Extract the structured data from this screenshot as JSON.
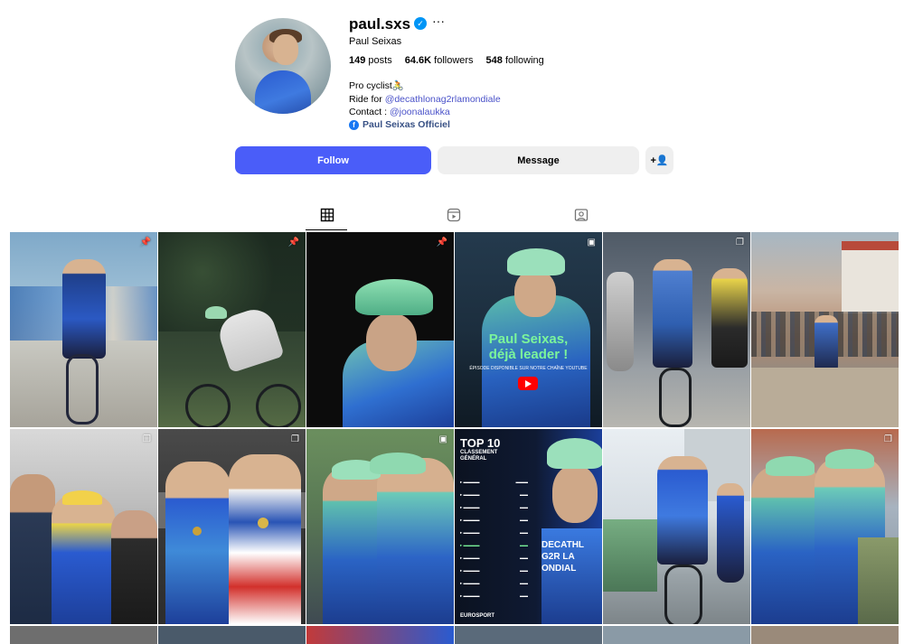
{
  "profile": {
    "username": "paul.sxs",
    "full_name": "Paul Seixas",
    "stats": {
      "posts_count": "149",
      "posts_label": "posts",
      "followers_count": "64.6K",
      "followers_label": "followers",
      "following_count": "548",
      "following_label": "following"
    },
    "bio": {
      "line1": "Pro cyclist🚴",
      "line2_prefix": "Ride for ",
      "line2_link": "@decathlonag2rlamondiale",
      "line3_prefix": "Contact : ",
      "line3_link": "@joonalaukka"
    },
    "facebook_link": "Paul Seixas Officiel"
  },
  "actions": {
    "follow": "Follow",
    "message": "Message",
    "add_user": "+👤"
  },
  "tabs": [
    {
      "name": "posts",
      "icon": "grid-icon",
      "active": true
    },
    {
      "name": "reels",
      "icon": "reels-icon",
      "active": false
    },
    {
      "name": "tagged",
      "icon": "tagged-icon",
      "active": false
    }
  ],
  "posts": {
    "p4_title_line1": "Paul Seixas,",
    "p4_title_line2": "déjà leader !",
    "p4_sub": "ÉPISODE DISPONIBLE SUR NOTRE CHAÎNE YOUTUBE",
    "p10_title": "TOP 10",
    "p10_sub1": "CLASSEMENT",
    "p10_sub2": "GÉNÉRAL",
    "p10_brand": "EUROSPORT",
    "p10_jersey1": "DECATHL",
    "p10_jersey2": "G2R LA",
    "p10_jersey3": "ONDIAL"
  },
  "colors": {
    "accent": "#4a5df9",
    "link": "#4a52c9",
    "highlight_green": "#7bf59b"
  }
}
